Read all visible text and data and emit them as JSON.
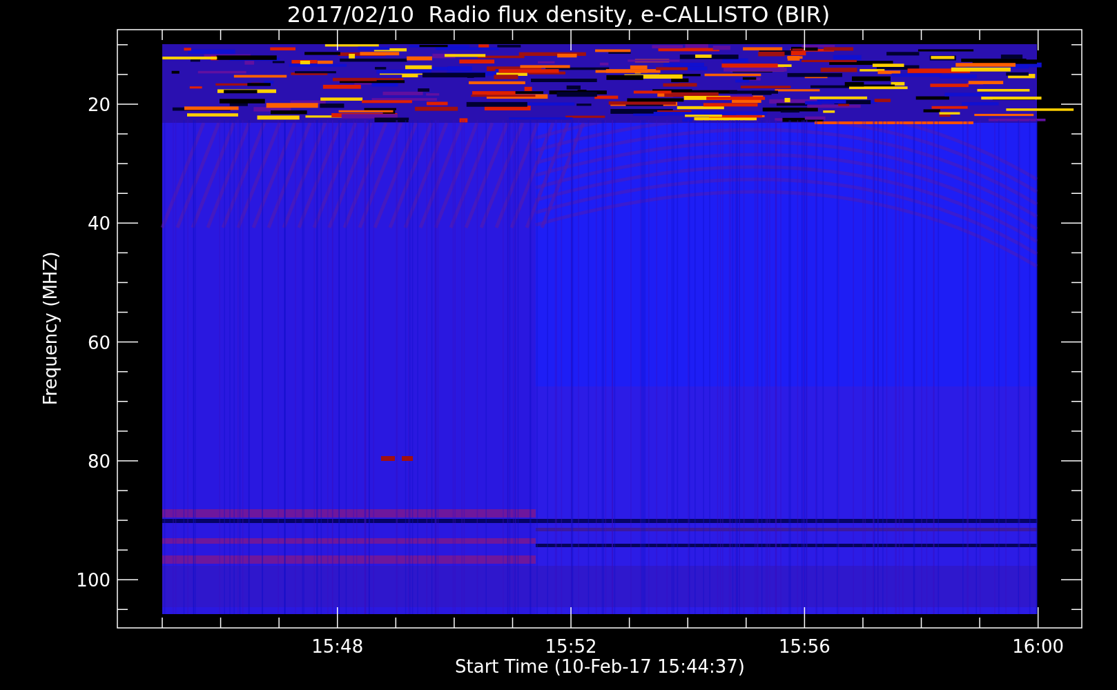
{
  "plot": {
    "title": "2017/02/10  Radio flux density, e-CALLISTO (BIR)",
    "ylabel": "Frequency (MHZ)",
    "xlabel": "Start Time (10-Feb-17 15:44:37)",
    "yticks": [
      "20",
      "40",
      "60",
      "80",
      "100"
    ],
    "xticks": [
      "15:48",
      "15:52",
      "15:56",
      "16:00"
    ]
  }
}
